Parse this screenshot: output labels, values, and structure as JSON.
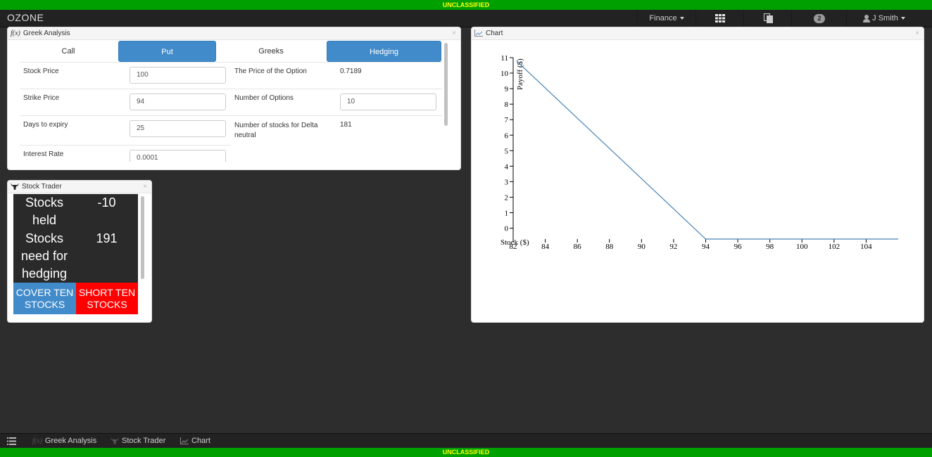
{
  "classification": {
    "top": "UNCLASSIFIED",
    "bottom": "UNCLASSIFIED"
  },
  "nav": {
    "brand": "OZONE",
    "finance_menu": "Finance",
    "apps_icon": "grid-icon",
    "pages_icon": "pages-icon",
    "notifications_count": "2",
    "user_name": "J Smith"
  },
  "greek": {
    "title": "Greek Analysis",
    "tabs": [
      "Call",
      "Put",
      "Greeks",
      "Hedging"
    ],
    "active_tabs": [
      "Put",
      "Hedging"
    ],
    "rows": {
      "stock_price": {
        "label": "Stock Price",
        "value": "100"
      },
      "strike_price": {
        "label": "Strike Price",
        "value": "94"
      },
      "days_to_expiry": {
        "label": "Days to expiry",
        "value": "25"
      },
      "interest_rate": {
        "label": "Interest Rate",
        "value": "0.0001"
      },
      "option_price": {
        "label": "The Price of the Option",
        "value": "0.7189"
      },
      "num_options": {
        "label": "Number of Options",
        "value": "10"
      },
      "delta_neutral_line1": "Number of stocks for Delta",
      "delta_neutral_line2": "neutral",
      "delta_neutral_value": "181"
    }
  },
  "trader": {
    "title": "Stock Trader",
    "held_line1": "Stocks",
    "held_line2": "held",
    "held_value": "-10",
    "need_line1": "Stocks",
    "need_line2": "need for",
    "need_line3": "hedging",
    "need_value": "191",
    "cover_line1": "COVER TEN",
    "cover_line2": "STOCKS",
    "short_line1": "SHORT TEN",
    "short_line2": "STOCKS",
    "colors": {
      "cover": "#428bca",
      "short": "#ff0000"
    }
  },
  "chart_panel": {
    "title": "Chart"
  },
  "chart_data": {
    "type": "line",
    "title": "",
    "xlabel": "Stock ($)",
    "ylabel": "Payoff ($)",
    "xlim": [
      82,
      106
    ],
    "ylim": [
      -0.7,
      11
    ],
    "xticks": [
      82,
      84,
      86,
      88,
      90,
      92,
      94,
      96,
      98,
      100,
      102,
      104
    ],
    "yticks": [
      0,
      1,
      2,
      3,
      4,
      5,
      6,
      7,
      8,
      9,
      10,
      11
    ],
    "grid": false,
    "series": [
      {
        "color": "#4682b4",
        "x": [
          82.2,
          94,
          106
        ],
        "y": [
          10.8,
          -0.7,
          -0.7
        ]
      }
    ]
  },
  "taskbar": {
    "items": [
      "Greek Analysis",
      "Stock Trader",
      "Chart"
    ]
  }
}
